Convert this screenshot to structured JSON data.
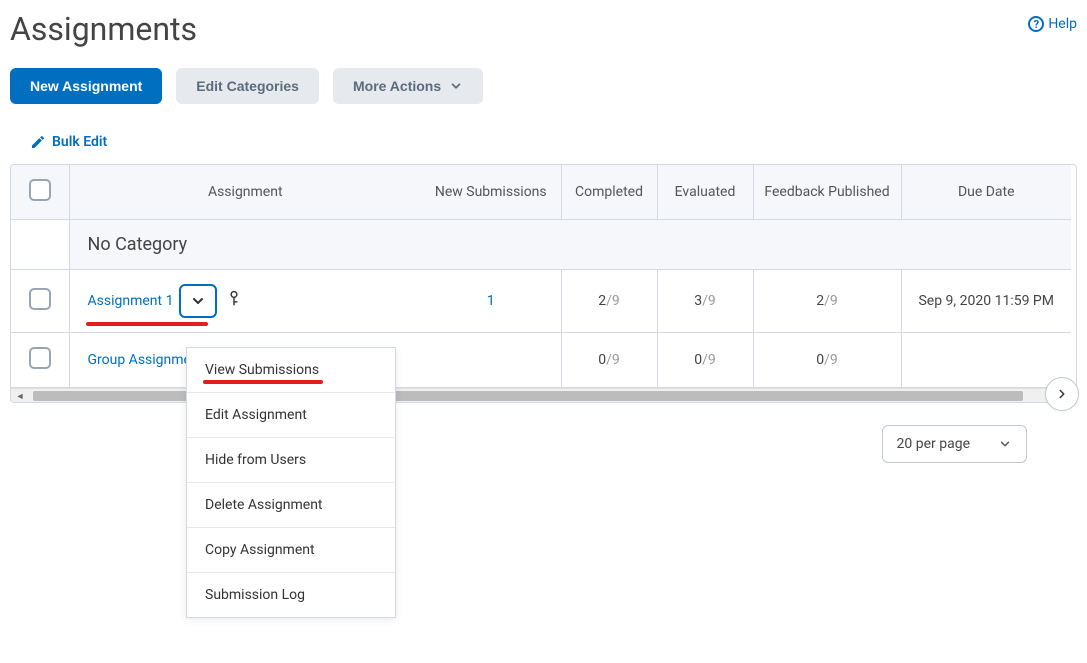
{
  "header": {
    "title": "Assignments",
    "help_label": "Help"
  },
  "toolbar": {
    "new_assignment": "New Assignment",
    "edit_categories": "Edit Categories",
    "more_actions": "More Actions"
  },
  "bulk_edit": {
    "label": "Bulk Edit"
  },
  "table": {
    "columns": {
      "assignment": "Assignment",
      "new_submissions": "New Submissions",
      "completed": "Completed",
      "evaluated": "Evaluated",
      "feedback_published": "Feedback Published",
      "due_date": "Due Date"
    },
    "category_label": "No Category",
    "rows": [
      {
        "name": "Assignment 1",
        "new_submissions": "1",
        "completed_num": "2",
        "completed_den": "/9",
        "evaluated_num": "3",
        "evaluated_den": "/9",
        "feedback_num": "2",
        "feedback_den": "/9",
        "due": "Sep 9, 2020 11:59 PM",
        "has_key": true,
        "menu_open": true
      },
      {
        "name": "Group Assignment",
        "new_submissions": "",
        "completed_num": "0",
        "completed_den": "/9",
        "evaluated_num": "0",
        "evaluated_den": "/9",
        "feedback_num": "0",
        "feedback_den": "/9",
        "due": "",
        "has_key": false,
        "menu_open": false
      }
    ]
  },
  "context_menu": {
    "items": [
      "View Submissions",
      "Edit Assignment",
      "Hide from Users",
      "Delete Assignment",
      "Copy Assignment",
      "Submission Log"
    ]
  },
  "pager": {
    "per_page": "20 per page"
  }
}
